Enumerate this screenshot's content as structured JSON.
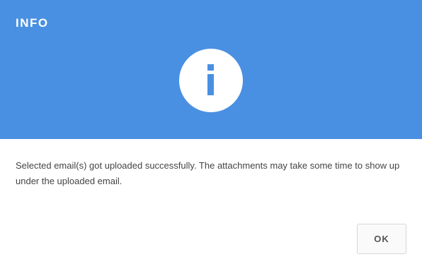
{
  "dialog": {
    "title": "INFO",
    "icon": "info-icon",
    "message": "Selected email(s) got uploaded successfully. The attachments may take some time to show up under the uploaded email.",
    "ok_label": "OK"
  },
  "colors": {
    "header_background": "#4a90e2",
    "icon_background": "#ffffff",
    "icon_glyph": "#4a90e2",
    "text": "#444444",
    "button_border": "#d6d6d6"
  }
}
